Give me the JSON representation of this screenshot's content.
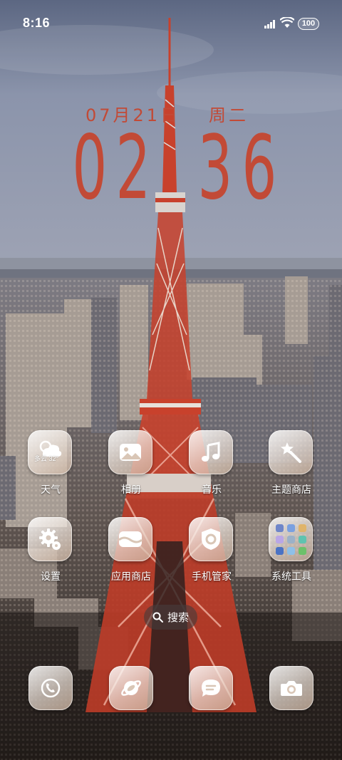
{
  "status_bar": {
    "time": "8:16",
    "battery": "100"
  },
  "clock": {
    "date": "07月21日",
    "weekday": "周二",
    "digits": [
      "0",
      "2",
      "3",
      "6"
    ]
  },
  "apps": [
    {
      "label": "天气",
      "mini_text": "多云 32°",
      "icon": "weather-icon"
    },
    {
      "label": "相册",
      "icon": "gallery-icon"
    },
    {
      "label": "音乐",
      "icon": "music-icon"
    },
    {
      "label": "主题商店",
      "icon": "theme-wand-icon"
    },
    {
      "label": "设置",
      "icon": "gear-icon"
    },
    {
      "label": "应用商店",
      "icon": "app-store-icon"
    },
    {
      "label": "手机管家",
      "icon": "shield-icon"
    },
    {
      "label": "系统工具",
      "icon": "folder-icon"
    }
  ],
  "search": {
    "label": "搜索",
    "icon": "search-icon"
  },
  "dock": [
    {
      "icon": "phone-icon"
    },
    {
      "icon": "browser-icon"
    },
    {
      "icon": "message-icon"
    },
    {
      "icon": "camera-icon"
    }
  ],
  "colors": {
    "clock_red": "#c24a36",
    "tower_red": "#c8412c"
  }
}
